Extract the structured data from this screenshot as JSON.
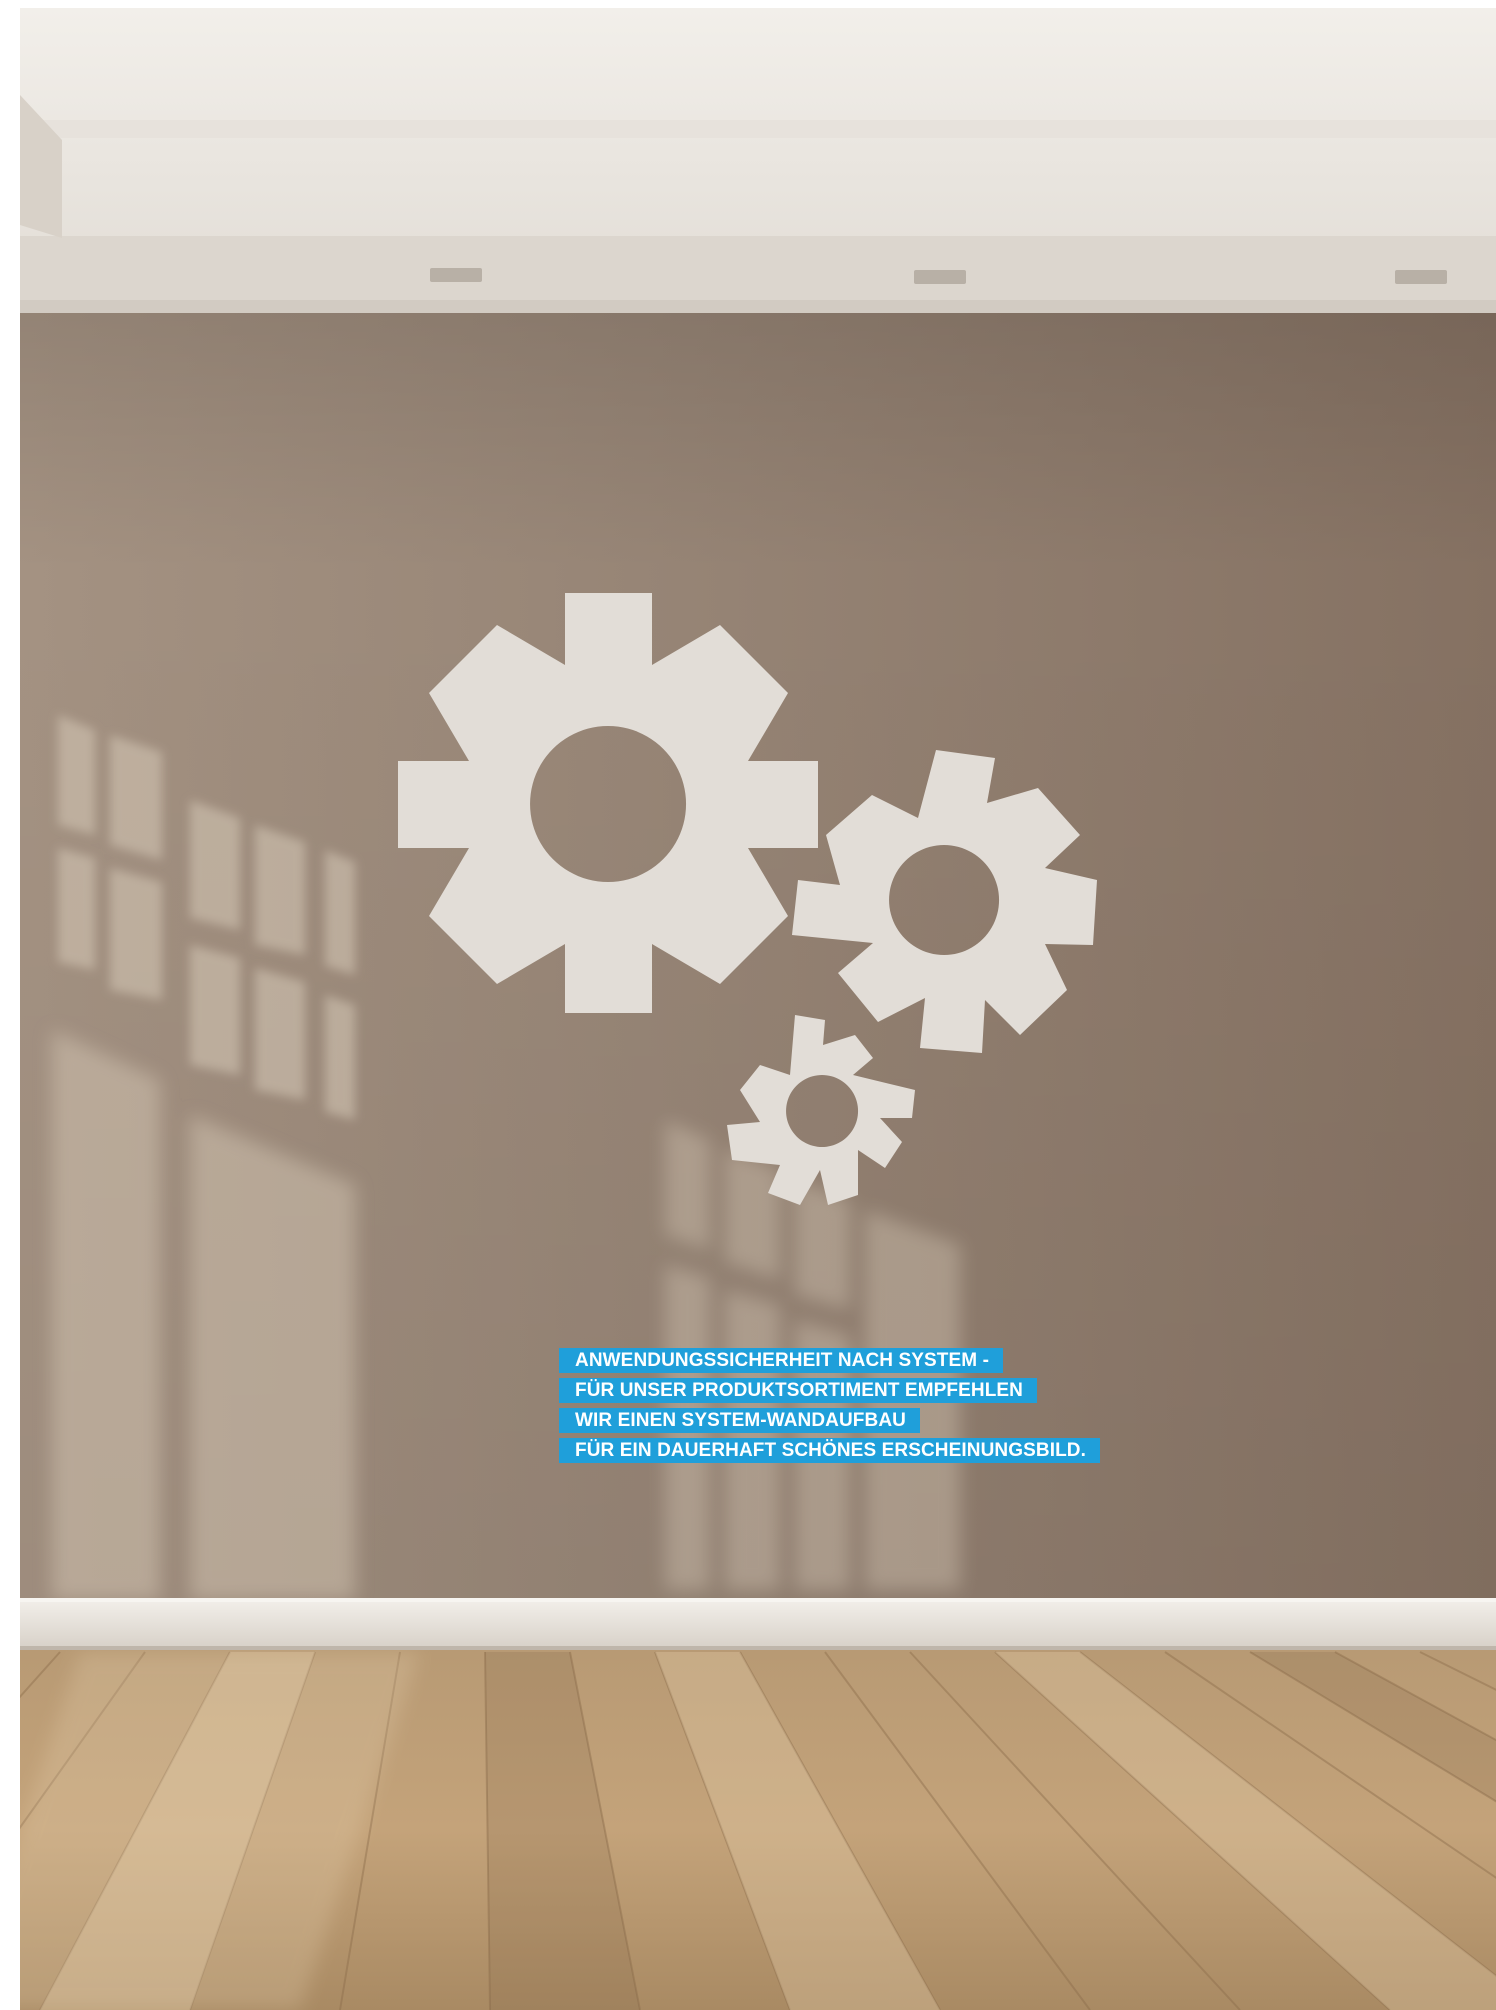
{
  "colors": {
    "ceiling": "#ece8e3",
    "wall": "#978576",
    "wall_dark": "#857061",
    "baseboard": "#ece8e3",
    "floor": "#c1a076",
    "floor_dark": "#8f7050",
    "gear": "#e1dcd6",
    "label_background": "#1f9fda",
    "label_text": "#ffffff",
    "window_light": "#d8cab8"
  },
  "icons": {
    "gear_large": "gear-icon",
    "gear_medium": "gear-icon",
    "gear_small": "gear-icon"
  },
  "headline": {
    "lines": [
      "ANWENDUNGSSICHERHEIT NACH SYSTEM -",
      "FÜR UNSER PRODUKTSORTIMENT EMPFEHLEN",
      "WIR EINEN SYSTEM-WANDAUFBAU",
      "FÜR EIN DAUERHAFT SCHÖNES ERSCHEINUNGSBILD."
    ]
  }
}
